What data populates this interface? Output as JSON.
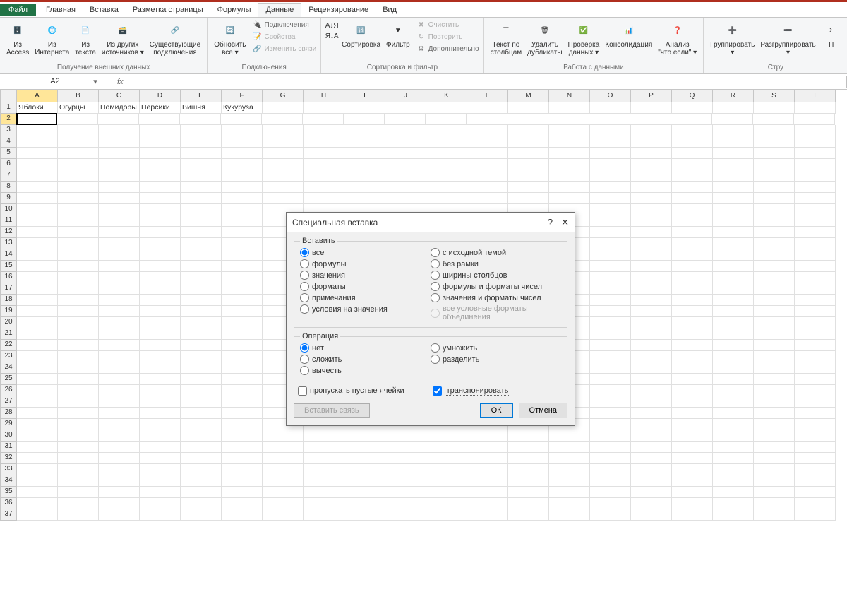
{
  "tabs": {
    "file": "Файл",
    "home": "Главная",
    "insert": "Вставка",
    "layout": "Разметка страницы",
    "formulas": "Формулы",
    "data": "Данные",
    "review": "Рецензирование",
    "view": "Вид"
  },
  "ribbon": {
    "ext_data": {
      "access": "Из\nAccess",
      "web": "Из\nИнтернета",
      "text": "Из\nтекста",
      "other": "Из других\nисточников ▾",
      "conn": "Существующие\nподключения",
      "label": "Получение внешних данных"
    },
    "connections": {
      "refresh": "Обновить\nвсе ▾",
      "props": "Подключения",
      "sv": "Свойства",
      "links": "Изменить связи",
      "label": "Подключения"
    },
    "sort": {
      "az": "А↓Я",
      "za": "Я↓А",
      "sort": "Сортировка",
      "filter": "Фильтр",
      "clear": "Очистить",
      "reapply": "Повторить",
      "adv": "Дополнительно",
      "label": "Сортировка и фильтр"
    },
    "tools": {
      "t2c": "Текст по\nстолбцам",
      "dup": "Удалить\nдубликаты",
      "val": "Проверка\nданных ▾",
      "cons": "Консолидация",
      "what": "Анализ\n\"что если\" ▾",
      "label": "Работа с данными"
    },
    "outline": {
      "group": "Группировать\n▾",
      "ungroup": "Разгруппировать\n▾",
      "sub": "П",
      "label": "Стру"
    }
  },
  "namebox": "A2",
  "columns": [
    "A",
    "B",
    "C",
    "D",
    "E",
    "F",
    "G",
    "H",
    "I",
    "J",
    "K",
    "L",
    "M",
    "N",
    "O",
    "P",
    "Q",
    "R",
    "S",
    "T"
  ],
  "data_row": [
    "Яблоки",
    "Огурцы",
    "Помидоры",
    "Персики",
    "Вишня",
    "Кукуруза"
  ],
  "dialog": {
    "title": "Специальная вставка",
    "help": "?",
    "insert_legend": "Вставить",
    "insert_left": [
      "все",
      "формулы",
      "значения",
      "форматы",
      "примечания",
      "условия на значения"
    ],
    "insert_right": [
      "с исходной темой",
      "без рамки",
      "ширины столбцов",
      "формулы и форматы чисел",
      "значения и форматы чисел",
      "все условные форматы объединения"
    ],
    "op_legend": "Операция",
    "op_left": [
      "нет",
      "сложить",
      "вычесть"
    ],
    "op_right": [
      "умножить",
      "разделить"
    ],
    "skip_blanks": "пропускать пустые ячейки",
    "transpose": "транспонировать",
    "paste_link": "Вставить связь",
    "ok": "ОК",
    "cancel": "Отмена"
  }
}
